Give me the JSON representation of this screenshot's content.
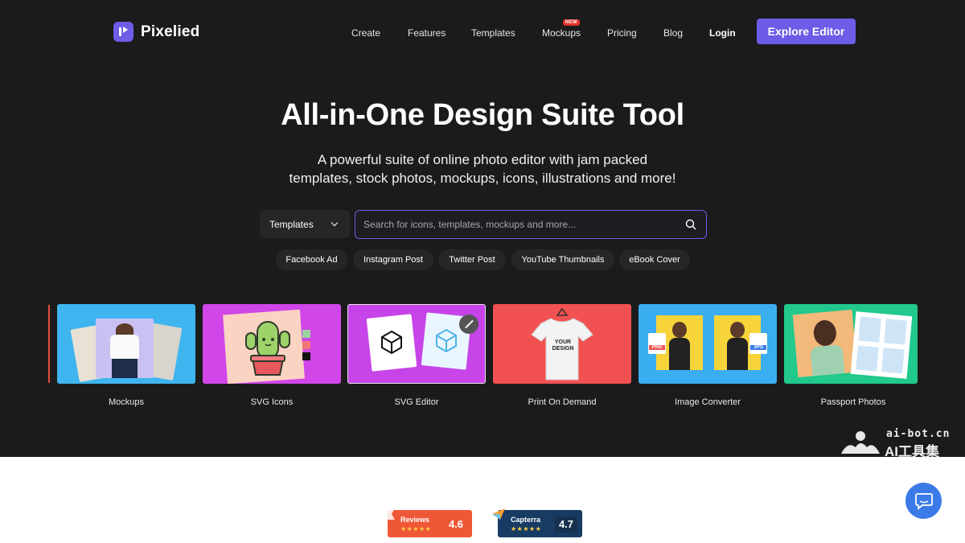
{
  "brand": {
    "name": "Pixelied",
    "accent": "#6c5ce7"
  },
  "nav": {
    "items": [
      "Create",
      "Features",
      "Templates",
      "Mockups",
      "Pricing",
      "Blog",
      "Login"
    ],
    "new_badge": "NEW",
    "cta": "Explore Editor"
  },
  "hero": {
    "title": "All-in-One Design Suite Tool",
    "subtitle_line1": "A powerful suite of online photo editor with jam packed",
    "subtitle_line2": "templates, stock photos, mockups, icons, illustrations and more!"
  },
  "search": {
    "type_selected": "Templates",
    "placeholder": "Search for icons, templates, mockups and more...",
    "chips": [
      "Facebook Ad",
      "Instagram Post",
      "Twitter Post",
      "YouTube Thumbnails",
      "eBook Cover"
    ]
  },
  "cards": [
    {
      "label": "Mockups",
      "bg": "#3fb5f0"
    },
    {
      "label": "SVG Icons",
      "bg": "#d046e8"
    },
    {
      "label": "SVG Editor",
      "bg": "#c744e8"
    },
    {
      "label": "Print On Demand",
      "bg": "#f25151"
    },
    {
      "label": "Image Converter",
      "bg": "#3aaef0"
    },
    {
      "label": "Passport Photos",
      "bg": "#21c98c"
    }
  ],
  "tshirt_text": "YOUR DESIGN",
  "formats": {
    "from": "PNG",
    "to": "JPG"
  },
  "reviews": [
    {
      "name": "Reviews",
      "stars": "★★★★★",
      "score": "4.6",
      "color": "#ef5837"
    },
    {
      "name": "Capterra",
      "stars": "★★★★★",
      "score": "4.7",
      "color": "#183b63"
    }
  ],
  "watermark": {
    "top": "ai-bot.cn",
    "bottom": "AI工具集"
  }
}
